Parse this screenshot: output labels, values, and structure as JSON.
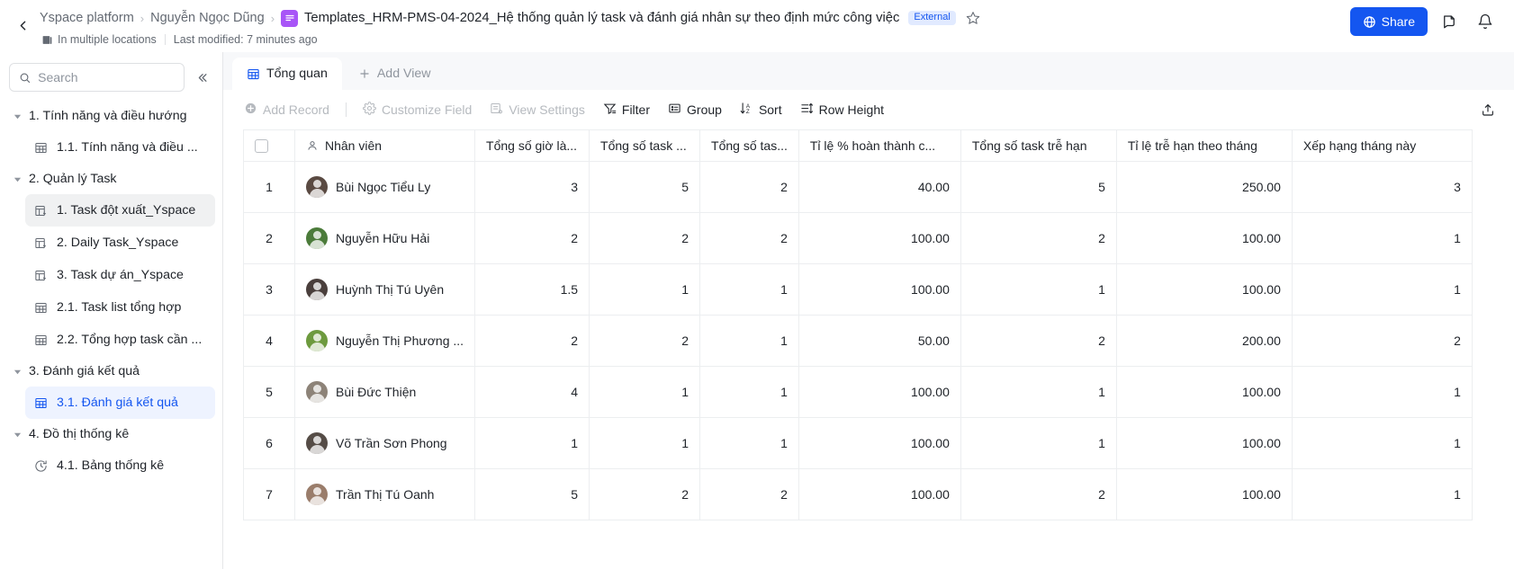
{
  "header": {
    "back_label": "Back",
    "breadcrumbs": [
      {
        "label": "Yspace platform"
      },
      {
        "label": "Nguyễn Ngọc Dũng"
      }
    ],
    "separator": "›",
    "doc_title": "Templates_HRM-PMS-04-2024_Hệ thống quản lý task và đánh giá nhân sự theo định mức công việc",
    "external_badge": "External",
    "location_text": "In multiple locations",
    "last_modified": "Last modified: 7 minutes ago",
    "share_label": "Share",
    "doc_icon_color": "#a855f7",
    "accent_color": "#1456f0",
    "badge_bg": "#e1eaff"
  },
  "sidebar": {
    "search": {
      "placeholder": "Search",
      "value": ""
    },
    "collapse_label": "«",
    "items": [
      {
        "label": "1. Tính năng và điều hướng",
        "type": "group",
        "expanded": true
      },
      {
        "label": "1.1. Tính năng và điều ...",
        "type": "table",
        "state": "none"
      },
      {
        "label": "2. Quản lý Task",
        "type": "group",
        "expanded": true
      },
      {
        "label": "1. Task đột xuất_Yspace",
        "type": "form",
        "state": "hover"
      },
      {
        "label": "2. Daily Task_Yspace",
        "type": "form",
        "state": "none"
      },
      {
        "label": "3. Task dự án_Yspace",
        "type": "form",
        "state": "none"
      },
      {
        "label": "2.1. Task list tổng hợp",
        "type": "table",
        "state": "none"
      },
      {
        "label": "2.2. Tổng hợp task cần ...",
        "type": "table",
        "state": "none"
      },
      {
        "label": "3. Đánh giá kết quả",
        "type": "group",
        "expanded": true
      },
      {
        "label": "3.1. Đánh giá kết quả",
        "type": "table",
        "state": "selected"
      },
      {
        "label": "4. Đồ thị thống kê",
        "type": "group",
        "expanded": true
      },
      {
        "label": "4.1. Bảng thống kê",
        "type": "dashboard",
        "state": "none"
      }
    ]
  },
  "view_tabs": [
    {
      "label": "Tổng quan",
      "icon": "grid-icon",
      "active": true
    },
    {
      "label": "Add View",
      "icon": "plus-icon",
      "active": false
    }
  ],
  "toolbar": [
    {
      "label": "Add Record",
      "icon": "plus-circle-icon",
      "disabled": true
    },
    {
      "label": "Customize Field",
      "icon": "gear-icon",
      "disabled": true
    },
    {
      "label": "View Settings",
      "icon": "view-settings-icon",
      "disabled": true
    },
    {
      "label": "Filter",
      "icon": "filter-icon",
      "disabled": false
    },
    {
      "label": "Group",
      "icon": "group-icon",
      "disabled": false
    },
    {
      "label": "Sort",
      "icon": "sort-icon",
      "disabled": false
    },
    {
      "label": "Row Height",
      "icon": "row-height-icon",
      "disabled": false
    }
  ],
  "table": {
    "columns": [
      {
        "key": "rownum",
        "label": "",
        "type": "rownum"
      },
      {
        "key": "employee",
        "label": "Nhân viên",
        "type": "person",
        "icon": "person-icon"
      },
      {
        "key": "total_hours",
        "label": "Tổng số giờ là...",
        "type": "number"
      },
      {
        "key": "total_tasks",
        "label": "Tổng số task ...",
        "type": "number"
      },
      {
        "key": "total_tasks_2",
        "label": "Tổng số tas...",
        "type": "number"
      },
      {
        "key": "completion_rate",
        "label": "Tỉ lệ % hoàn thành c...",
        "type": "number"
      },
      {
        "key": "late_tasks",
        "label": "Tổng số task trễ hạn",
        "type": "number"
      },
      {
        "key": "late_rate_month",
        "label": "Tỉ lệ trễ hạn theo tháng",
        "type": "number"
      },
      {
        "key": "rank_month",
        "label": "Xếp hạng tháng này",
        "type": "number"
      }
    ],
    "rows": [
      {
        "rownum": "1",
        "employee": "Bùi Ngọc Tiểu Ly",
        "avatar_color": "#5a4a42",
        "total_hours": "3",
        "total_tasks": "5",
        "total_tasks_2": "2",
        "completion_rate": "40.00",
        "late_tasks": "5",
        "late_rate_month": "250.00",
        "rank_month": "3"
      },
      {
        "rownum": "2",
        "employee": "Nguyễn Hữu Hải",
        "avatar_color": "#4b7b3a",
        "total_hours": "2",
        "total_tasks": "2",
        "total_tasks_2": "2",
        "completion_rate": "100.00",
        "late_tasks": "2",
        "late_rate_month": "100.00",
        "rank_month": "1"
      },
      {
        "rownum": "3",
        "employee": "Huỳnh Thị Tú Uyên",
        "avatar_color": "#4a3f3c",
        "total_hours": "1.5",
        "total_tasks": "1",
        "total_tasks_2": "1",
        "completion_rate": "100.00",
        "late_tasks": "1",
        "late_rate_month": "100.00",
        "rank_month": "1"
      },
      {
        "rownum": "4",
        "employee": "Nguyễn Thị Phương ...",
        "avatar_color": "#6d9a3e",
        "total_hours": "2",
        "total_tasks": "2",
        "total_tasks_2": "1",
        "completion_rate": "50.00",
        "late_tasks": "2",
        "late_rate_month": "200.00",
        "rank_month": "2"
      },
      {
        "rownum": "5",
        "employee": "Bùi Đức Thiện",
        "avatar_color": "#8d8378",
        "total_hours": "4",
        "total_tasks": "1",
        "total_tasks_2": "1",
        "completion_rate": "100.00",
        "late_tasks": "1",
        "late_rate_month": "100.00",
        "rank_month": "1"
      },
      {
        "rownum": "6",
        "employee": "Võ Trần Sơn Phong",
        "avatar_color": "#554c46",
        "total_hours": "1",
        "total_tasks": "1",
        "total_tasks_2": "1",
        "completion_rate": "100.00",
        "late_tasks": "1",
        "late_rate_month": "100.00",
        "rank_month": "1"
      },
      {
        "rownum": "7",
        "employee": "Trần Thị Tú Oanh",
        "avatar_color": "#9a7d6b",
        "total_hours": "5",
        "total_tasks": "2",
        "total_tasks_2": "2",
        "completion_rate": "100.00",
        "late_tasks": "2",
        "late_rate_month": "100.00",
        "rank_month": "1"
      }
    ]
  }
}
